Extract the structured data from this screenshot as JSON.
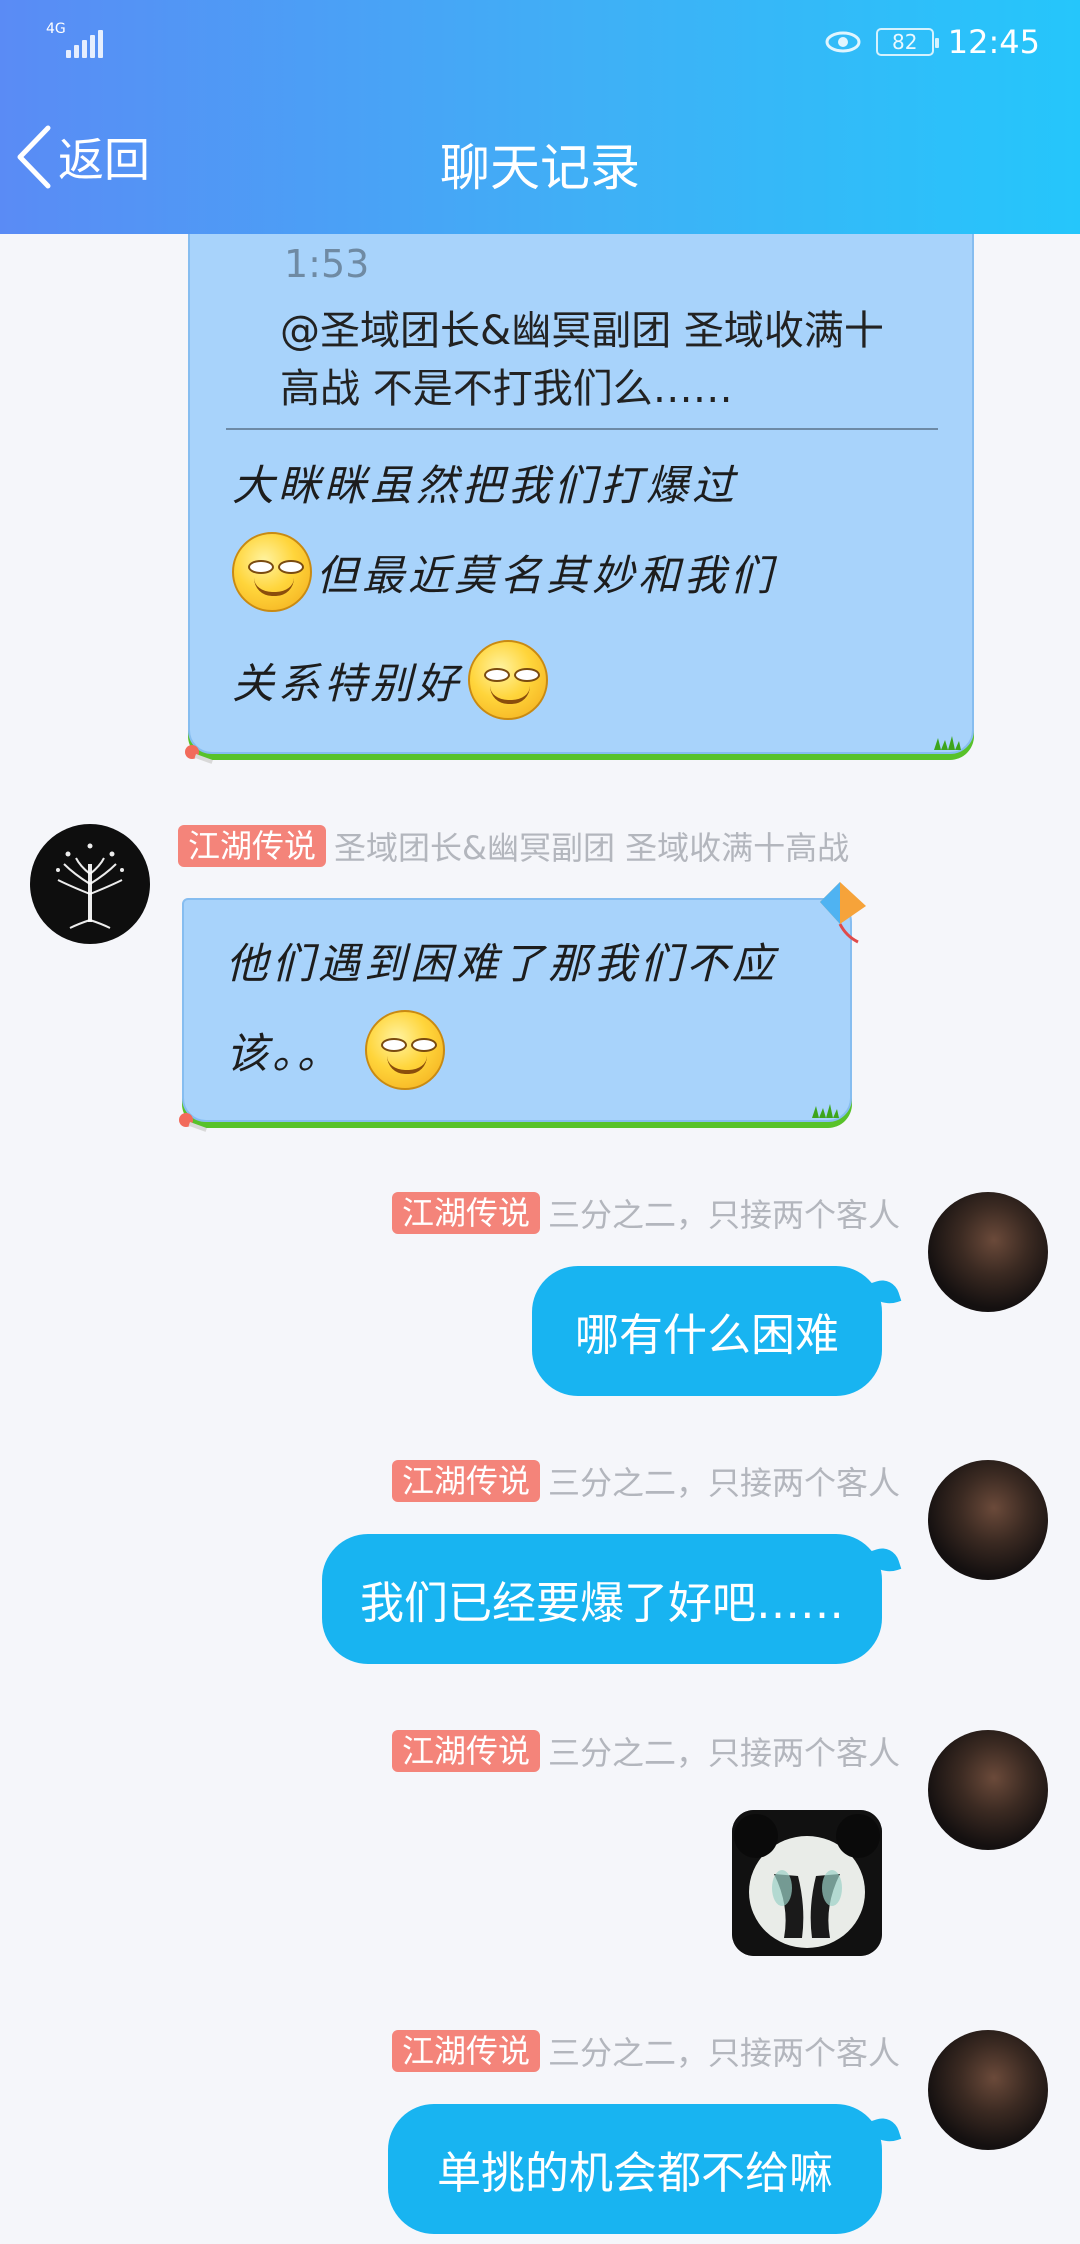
{
  "status_bar": {
    "network": "4G",
    "battery": "82",
    "time": "12:45"
  },
  "nav": {
    "back_label": "返回",
    "title": "聊天记录"
  },
  "quoted_card": {
    "quote_time": "1:53",
    "quote_text_line1": "@圣域团长&幽冥副团 圣域收满十",
    "quote_text_line2": "高战 不是不打我们么……",
    "reply_line1": "大眯眯虽然把我们打爆过",
    "reply_line2": "但最近莫名其妙和我们",
    "reply_line3": "关系特别好"
  },
  "messages": [
    {
      "tag": "江湖传说",
      "sender": "圣域团长&幽冥副团 圣域收满十高战",
      "line1": "他们遇到困难了那我们不应",
      "line2": "该。。"
    },
    {
      "tag": "江湖传说",
      "sender": "三分之二，只接两个客人",
      "text": "哪有什么困难"
    },
    {
      "tag": "江湖传说",
      "sender": "三分之二，只接两个客人",
      "text": "我们已经要爆了好吧……"
    },
    {
      "tag": "江湖传说",
      "sender": "三分之二，只接两个客人",
      "sticker": "panda-facepalm-sticker"
    },
    {
      "tag": "江湖传说",
      "sender": "三分之二，只接两个客人",
      "text": "单挑的机会都不给嘛"
    }
  ],
  "colors": {
    "header_start": "#5a8bf5",
    "header_end": "#25c6fb",
    "outgoing_bubble": "#18b4f1",
    "incoming_bubble": "#a8d3fb",
    "tag": "#f4847a"
  }
}
